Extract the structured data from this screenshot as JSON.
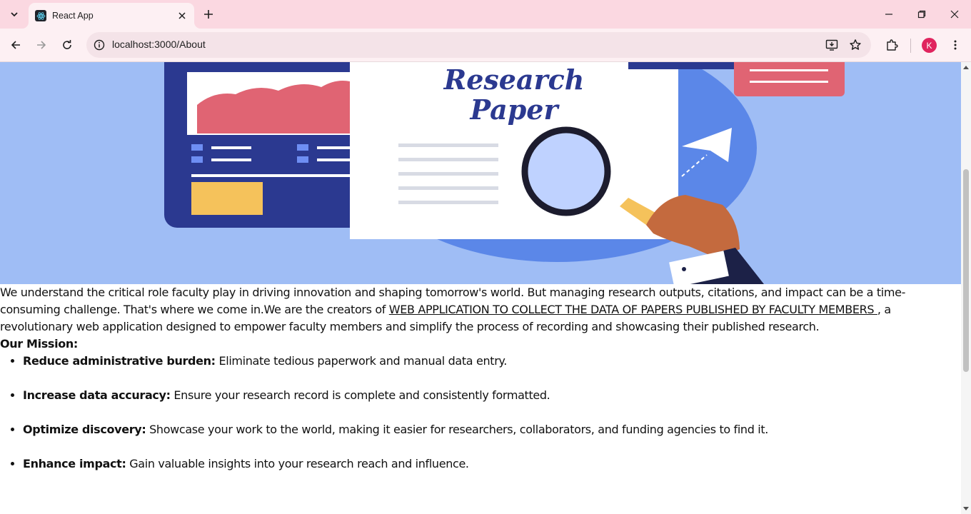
{
  "browser": {
    "tab_title": "React App",
    "url": "localhost:3000/About",
    "profile_initial": "K",
    "accent": "#fbd8e1"
  },
  "hero": {
    "image_text_line1": "Research",
    "image_text_line2": "Paper"
  },
  "about": {
    "intro_part1": "We understand the critical role faculty play in driving innovation and shaping tomorrow's world. But managing research outputs, citations, and impact can be a time-consuming challenge. That's where we come in.We are the creators of ",
    "intro_link": "WEB APPLICATION TO COLLECT THE DATA OF PAPERS PUBLISHED BY FACULTY MEMBERS ",
    "intro_part2": ", a revolutionary web application designed to empower faculty members and simplify the process of recording and showcasing their published research.",
    "mission_title": "Our Mission:",
    "mission_items": [
      {
        "title": "Reduce administrative burden:",
        "text": " Eliminate tedious paperwork and manual data entry."
      },
      {
        "title": "Increase data accuracy:",
        "text": " Ensure your research record is complete and consistently formatted."
      },
      {
        "title": "Optimize discovery:",
        "text": " Showcase your work to the world, making it easier for researchers, collaborators, and funding agencies to find it."
      },
      {
        "title": "Enhance impact:",
        "text": " Gain valuable insights into your research reach and influence."
      }
    ]
  }
}
